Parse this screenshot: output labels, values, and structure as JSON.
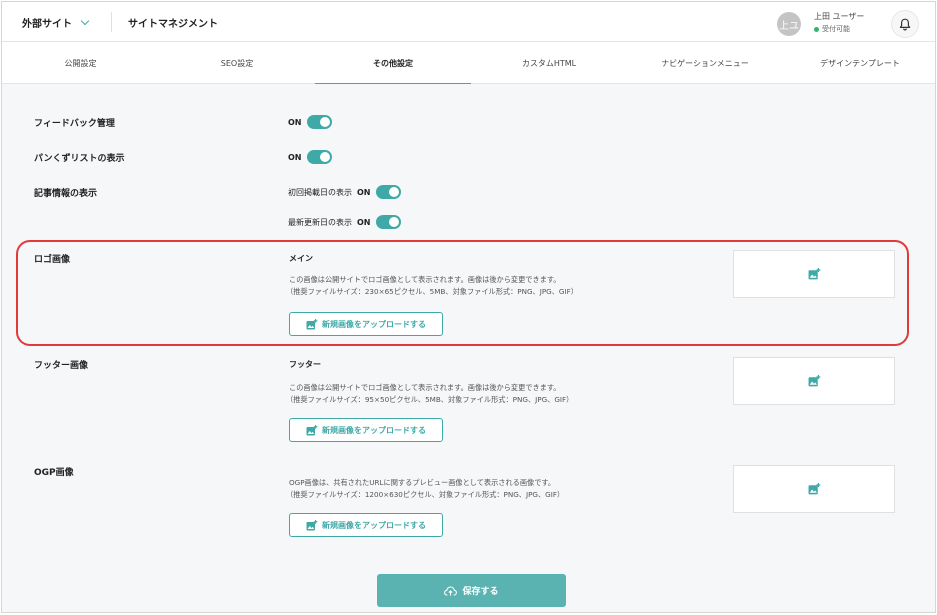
{
  "header": {
    "site_select_label": "外部サイト",
    "app_title": "サイトマネジメント",
    "user_avatar_initials": "上ユ",
    "user_name": "上田 ユーザー",
    "user_status": "受付可能"
  },
  "tabs": [
    {
      "label": "公開設定",
      "active": false
    },
    {
      "label": "SEO設定",
      "active": false
    },
    {
      "label": "その他設定",
      "active": true
    },
    {
      "label": "カスタムHTML",
      "active": false
    },
    {
      "label": "ナビゲーションメニュー",
      "active": false
    },
    {
      "label": "デザインテンプレート",
      "active": false
    }
  ],
  "settings": {
    "feedback": {
      "label": "フィードバック管理",
      "toggle_text": "ON"
    },
    "breadcrumb": {
      "label": "パンくずリストの表示",
      "toggle_text": "ON"
    },
    "article_info": {
      "label": "記事情報の表示",
      "first_published_label": "初回掲載日の表示",
      "first_published_toggle": "ON",
      "last_updated_label": "最新更新日の表示",
      "last_updated_toggle": "ON"
    }
  },
  "images": {
    "logo": {
      "label": "ロゴ画像",
      "subtitle": "メイン",
      "desc1": "この画像は公開サイトでロゴ画像として表示されます。画像は後から変更できます。",
      "desc2": "（推奨ファイルサイズ：230×65ピクセル、5MB、対象ファイル形式：PNG、JPG、GIF）",
      "upload_label": "新規画像をアップロードする"
    },
    "footer": {
      "label": "フッター画像",
      "subtitle": "フッター",
      "desc1": "この画像は公開サイトでロゴ画像として表示されます。画像は後から変更できます。",
      "desc2": "（推奨ファイルサイズ：95×50ピクセル、5MB、対象ファイル形式：PNG、JPG、GIF）",
      "upload_label": "新規画像をアップロードする"
    },
    "ogp": {
      "label": "OGP画像",
      "desc1": "OGP画像は、共有されたURLに関するプレビュー画像として表示される画像です。",
      "desc2": "（推奨ファイルサイズ：1200×630ピクセル、対象ファイル形式：PNG、JPG、GIF）",
      "upload_label": "新規画像をアップロードする"
    }
  },
  "save_label": "保存する",
  "colors": {
    "accent": "#3fa9a7",
    "highlight": "#e03a3a",
    "status_online": "#33b36b"
  },
  "icons": {
    "site_select": "chevron-down-icon",
    "notification": "bell-icon",
    "upload": "image-add-icon",
    "preview": "image-add-icon",
    "save": "cloud-upload-icon"
  }
}
